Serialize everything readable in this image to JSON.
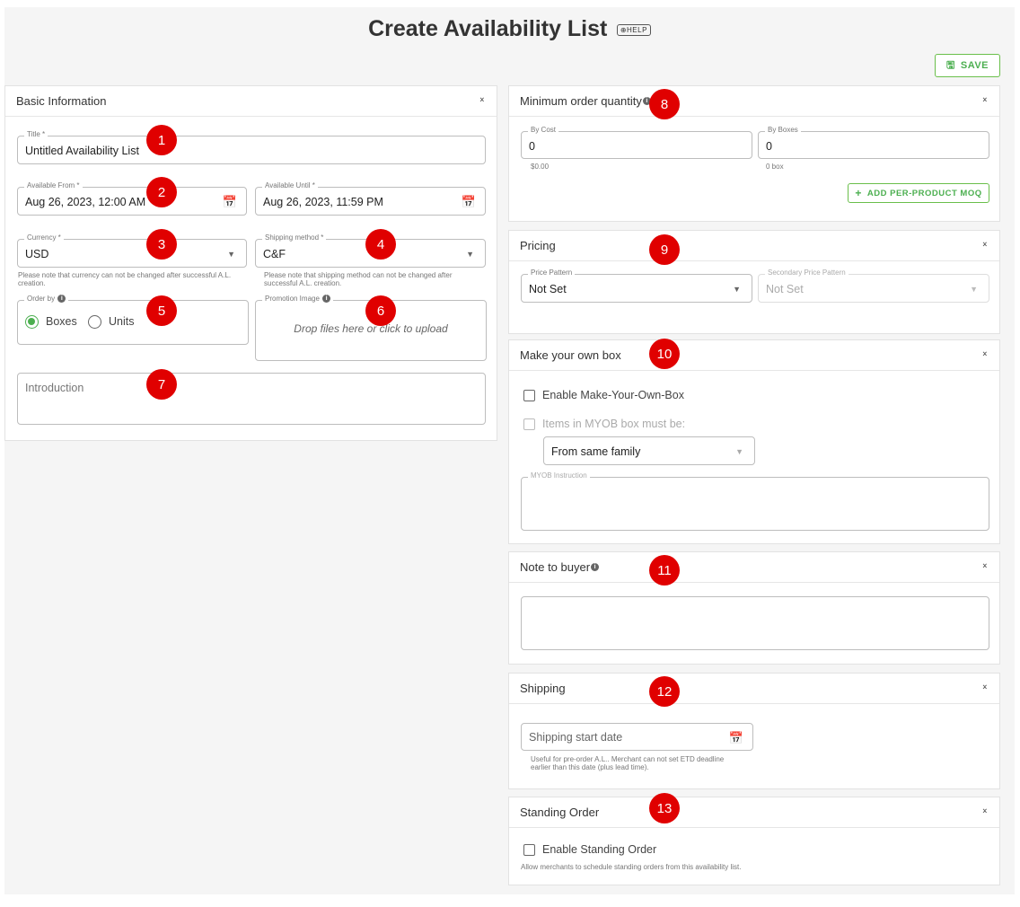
{
  "page": {
    "title": "Create Availability List",
    "help_label": "HELP",
    "save_label": "SAVE"
  },
  "basic_info": {
    "header": "Basic Information",
    "title_label": "Title *",
    "title_value": "Untitled Availability List",
    "available_from_label": "Available From *",
    "available_from_value": "Aug 26, 2023, 12:00 AM",
    "available_until_label": "Available Until *",
    "available_until_value": "Aug 26, 2023, 11:59 PM",
    "currency_label": "Currency *",
    "currency_value": "USD",
    "currency_hint": "Please note that currency can not be changed after successful A.L. creation.",
    "shipping_method_label": "Shipping method *",
    "shipping_method_value": "C&F",
    "shipping_method_hint": "Please note that shipping method can not be changed after successful A.L. creation.",
    "order_by_label": "Order by",
    "order_by_options": [
      "Boxes",
      "Units"
    ],
    "order_by_selected": "Boxes",
    "promotion_image_label": "Promotion Image",
    "promotion_image_placeholder": "Drop files here or click to upload",
    "introduction_placeholder": "Introduction"
  },
  "moq": {
    "header": "Minimum order quantity",
    "by_cost_label": "By Cost",
    "by_cost_value": "0",
    "by_cost_hint": "$0.00",
    "by_boxes_label": "By Boxes",
    "by_boxes_value": "0",
    "by_boxes_hint": "0 box",
    "add_button": "ADD PER-PRODUCT MOQ"
  },
  "pricing": {
    "header": "Pricing",
    "price_pattern_label": "Price Pattern",
    "price_pattern_value": "Not Set",
    "secondary_label": "Secondary Price Pattern",
    "secondary_value": "Not Set"
  },
  "myob": {
    "header": "Make your own box",
    "enable_label": "Enable Make-Your-Own-Box",
    "items_label": "Items in MYOB box must be:",
    "family_value": "From same family",
    "instruction_label": "MYOB Instruction"
  },
  "note": {
    "header": "Note to buyer"
  },
  "shipping": {
    "header": "Shipping",
    "start_date_placeholder": "Shipping start date",
    "hint": "Useful for pre-order A.L.. Merchant can not set ETD deadline earlier than this date (plus lead time)."
  },
  "standing": {
    "header": "Standing Order",
    "enable_label": "Enable Standing Order",
    "hint": "Allow merchants to schedule standing orders from this availability list."
  },
  "badges": [
    "1",
    "2",
    "3",
    "4",
    "5",
    "6",
    "7",
    "8",
    "9",
    "10",
    "11",
    "12",
    "13"
  ],
  "icons": {
    "calendar": "calendar-icon",
    "dropdown": "chevron-down-icon",
    "collapse": "collapse-icon",
    "info": "info-icon",
    "save": "save-icon",
    "add": "plus-icon",
    "help": "help-icon"
  },
  "colors": {
    "accent": "#4caf50",
    "badge": "#e00000"
  }
}
